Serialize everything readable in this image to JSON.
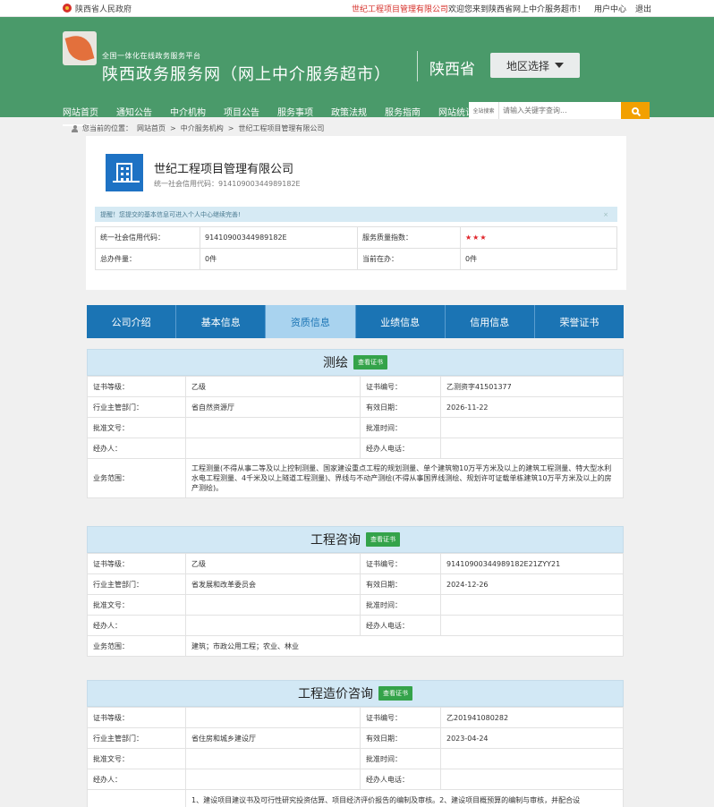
{
  "topbar": {
    "gov_name": "陕西省人民政府",
    "welcome_company": "世纪工程项目管理有限公司",
    "welcome_text": "欢迎您来到陕西省网上中介服务超市！",
    "user_center": "用户中心",
    "logout": "退出"
  },
  "header": {
    "subtitle": "全国一体化在线政务服务平台",
    "title": "陕西政务服务网（网上中介服务超市）",
    "province": "陕西省",
    "region_select": "地区选择"
  },
  "nav": {
    "items": [
      "网站首页",
      "通知公告",
      "中介机构",
      "项目公告",
      "服务事项",
      "政策法规",
      "服务指南",
      "网站统计"
    ]
  },
  "search": {
    "scope": "全站搜索",
    "placeholder": "请输入关键字查询..."
  },
  "breadcrumb": {
    "prefix": "您当前的位置：",
    "items": [
      "网站首页",
      ">",
      "中介服务机构",
      ">",
      "世纪工程项目管理有限公司"
    ]
  },
  "company": {
    "name": "世纪工程项目管理有限公司",
    "credit_code_label": "统一社会信用代码：",
    "credit_code": "91410900344989182E"
  },
  "tip": {
    "text": "提醒！您提交的基本信息可进入个人中心继续完善!",
    "close": "×"
  },
  "info": {
    "rows": [
      [
        "统一社会信用代码：",
        "91410900344989182E",
        "服务质量指数：",
        "★★★"
      ],
      [
        "总办件量：",
        "0件",
        "当前在办：",
        "0件"
      ]
    ]
  },
  "tabs": [
    "公司介绍",
    "基本信息",
    "资质信息",
    "业绩信息",
    "信用信息",
    "荣誉证书"
  ],
  "sections": [
    {
      "title": "测绘",
      "cert_btn": "查看证书",
      "rows": [
        [
          "证书等级：",
          "乙级",
          "证书编号：",
          "乙测资字41501377"
        ],
        [
          "行业主管部门：",
          "省自然资源厅",
          "有效日期：",
          "2026-11-22"
        ],
        [
          "批准文号：",
          "",
          "批准时间：",
          ""
        ],
        [
          "经办人：",
          "",
          "经办人电话：",
          ""
        ]
      ],
      "scope_label": "业务范围：",
      "scope": "工程测量(不得从事二等及以上控制测量、国家建设重点工程的规划测量、单个建筑物10万平方米及以上的建筑工程测量、特大型水利水电工程测量、4千米及以上隧道工程测量)、界线与不动产测绘(不得从事国界线测绘、规划许可证载单栋建筑10万平方米及以上的房产测绘)。"
    },
    {
      "title": "工程咨询",
      "cert_btn": "查看证书",
      "rows": [
        [
          "证书等级：",
          "乙级",
          "证书编号：",
          "91410900344989182E21ZYY21"
        ],
        [
          "行业主管部门：",
          "省发展和改革委员会",
          "有效日期：",
          "2024-12-26"
        ],
        [
          "批准文号：",
          "",
          "批准时间：",
          ""
        ],
        [
          "经办人：",
          "",
          "经办人电话：",
          ""
        ]
      ],
      "scope_label": "业务范围：",
      "scope": "建筑；市政公用工程；农业、林业"
    },
    {
      "title": "工程造价咨询",
      "cert_btn": "查看证书",
      "rows": [
        [
          "证书等级：",
          "",
          "证书编号：",
          "乙201941080282"
        ],
        [
          "行业主管部门：",
          "省住房和城乡建设厅",
          "有效日期：",
          "2023-04-24"
        ],
        [
          "批准文号：",
          "",
          "批准时间：",
          ""
        ],
        [
          "经办人：",
          "",
          "经办人电话：",
          ""
        ]
      ],
      "scope_label": "",
      "scope": "1、建设项目建议书及可行性研究投资估算、项目经济评价报告的编制及审核。2、建设项目概预算的编制与审核，并配合设"
    }
  ]
}
